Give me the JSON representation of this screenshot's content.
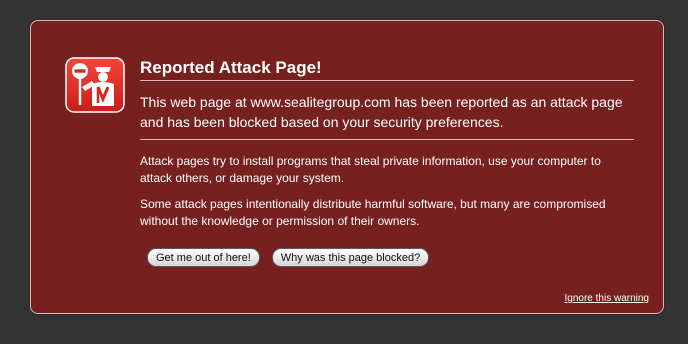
{
  "dialog": {
    "title": "Reported Attack Page!",
    "lead": "This web page at www.sealitegroup.com has been reported as an attack page and has been blocked based on your security preferences.",
    "detail_1": "Attack pages try to install programs that steal private information, use your computer to attack others, or damage your system.",
    "detail_2": "Some attack pages intentionally distribute harmful software, but many are compromised without the knowledge or permission of their owners.",
    "buttons": {
      "get_out": "Get me out of here!",
      "why_blocked": "Why was this page blocked?"
    },
    "ignore_link": "Ignore this warning"
  },
  "icon": "blocked-guard-icon",
  "colors": {
    "background": "#333333",
    "panel": "#76201f",
    "panel_border": "#d9b8b8",
    "icon_red": "#e0302a",
    "text": "#ffffff"
  }
}
